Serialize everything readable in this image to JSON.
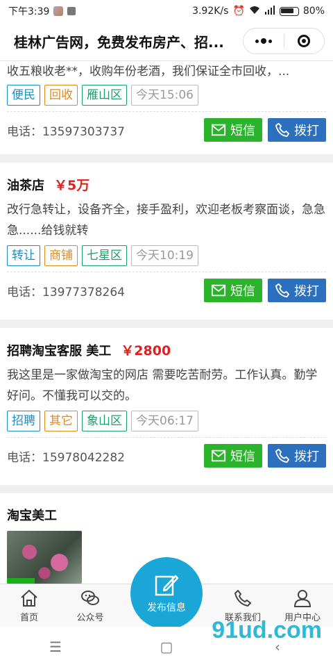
{
  "status_bar": {
    "time": "下午3:39",
    "speed": "3.92K/s",
    "battery": "80%"
  },
  "navbar": {
    "title": "桂林广告网，免费发布房产、招..."
  },
  "listings": [
    {
      "title": "",
      "price": "",
      "desc": "收五粮收老**，收购年份老酒，我们保证全市回收，...",
      "tags": [
        "便民",
        "回收",
        "雁山区",
        "今天15:06"
      ],
      "phone": "电话：13597303737"
    },
    {
      "title": "油茶店",
      "price": "￥5万",
      "desc": "改行急转让，设备齐全，接手盈利，欢迎老板考察面谈，急急急......给钱就转",
      "tags": [
        "转让",
        "商铺",
        "七星区",
        "今天10:19"
      ],
      "phone": "电话：13977378264"
    },
    {
      "title": "招聘淘宝客服 美工",
      "price": "￥2800",
      "desc": "我这里是一家做淘宝的网店 需要吃苦耐劳。工作认真。勤学好问。不懂我可以交的。",
      "tags": [
        "招聘",
        "其它",
        "象山区",
        "今天06:17"
      ],
      "phone": "电话：15978042282"
    },
    {
      "title": "淘宝美工",
      "price": "",
      "desc": "",
      "tags": [],
      "phone": ""
    }
  ],
  "buttons": {
    "sms": "短信",
    "call": "拨打"
  },
  "tabbar": {
    "home": "首页",
    "official": "公众号",
    "publish": "发布信息",
    "contact": "联系我们",
    "user": "用户中心"
  },
  "watermark": "91ud.com",
  "colors": {
    "sms_green": "#2bb32b",
    "call_blue": "#2b6fbd",
    "price_red": "#e02020",
    "publish_blue": "#1aa6d6"
  }
}
